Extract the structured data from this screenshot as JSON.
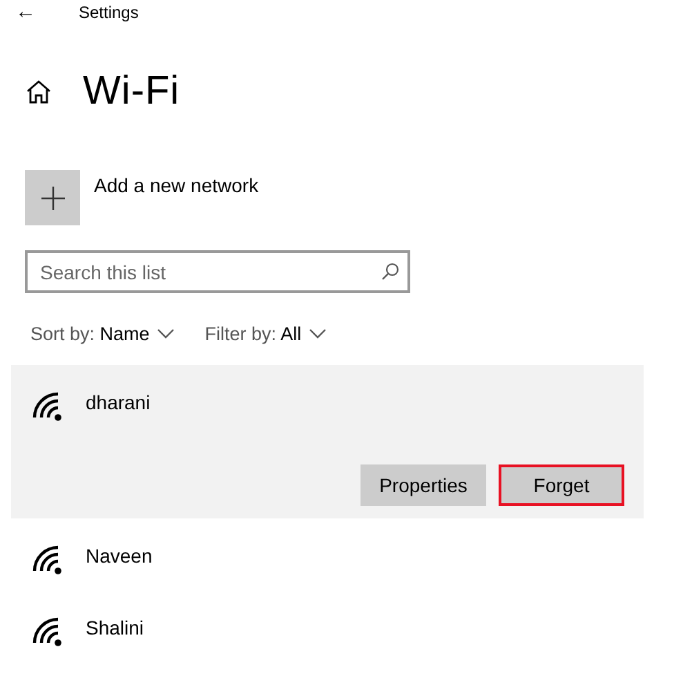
{
  "title_bar": {
    "back": "←",
    "title": "Settings"
  },
  "page": {
    "heading": "Wi-Fi"
  },
  "add_network": {
    "label": "Add a new network"
  },
  "search": {
    "placeholder": "Search this list"
  },
  "sort": {
    "text": "Sort by: **Name**"
  },
  "filter": {
    "text": "Filter by: **All**"
  },
  "networks": [
    {
      "name": "dharani",
      "selected": true,
      "actions": [
        {
          "label": "Properties",
          "highlighted": false
        },
        {
          "label": "Forget",
          "highlighted": true
        }
      ]
    },
    {
      "name": "Naveen",
      "selected": false
    },
    {
      "name": "Shalini",
      "selected": false
    }
  ]
}
